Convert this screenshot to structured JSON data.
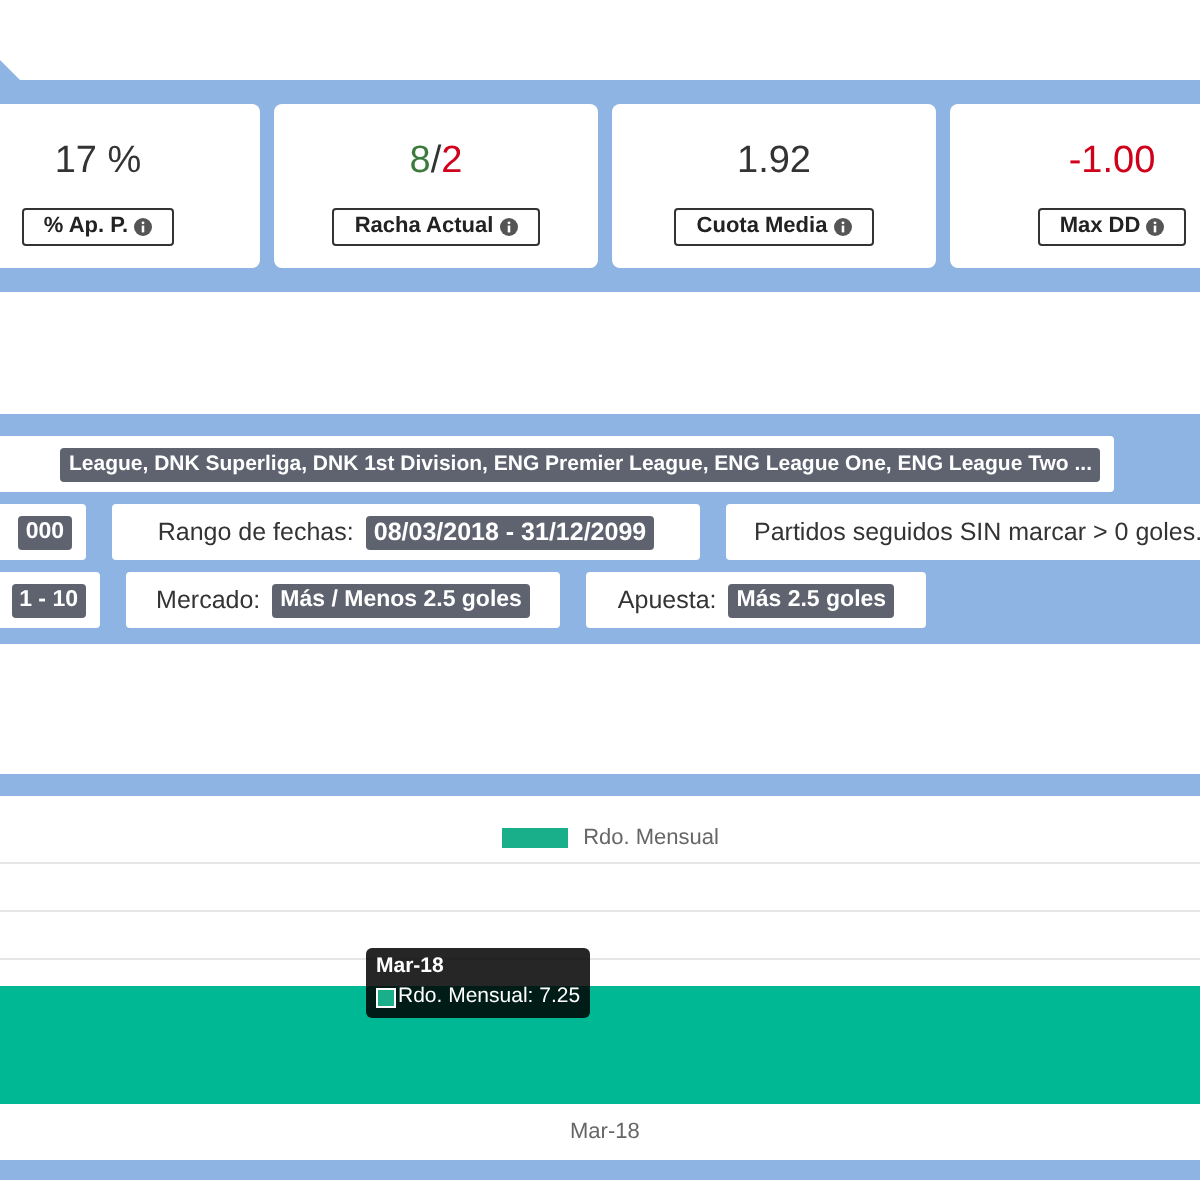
{
  "stats": [
    {
      "kind": "plain",
      "value": "17 %",
      "negative": false,
      "label": "% Ap. P."
    },
    {
      "kind": "streak",
      "wins": "8",
      "separator": "/",
      "losses": "2",
      "label": "Racha Actual"
    },
    {
      "kind": "plain",
      "value": "1.92",
      "negative": false,
      "label": "Cuota Media"
    },
    {
      "kind": "plain",
      "value": "-1.00",
      "negative": true,
      "label": "Max DD"
    }
  ],
  "filters": [
    [
      {
        "value": "League, DNK Superliga, DNK 1st Division, ENG Premier League, ENG League One, ENG League Two ..."
      }
    ],
    [
      {
        "value": "000"
      },
      {
        "label": "Rango de fechas:",
        "value": "08/03/2018 - 31/12/2099"
      },
      {
        "label": "Partidos seguidos SIN marcar > 0 goles."
      }
    ],
    [
      {
        "value": "1 - 10"
      },
      {
        "label": "Mercado:",
        "value": "Más / Menos 2.5 goles"
      },
      {
        "label": "Apuesta:",
        "value": "Más 2.5 goles"
      }
    ]
  ],
  "chart": {
    "legend": "Rdo. Mensual",
    "x_label": "Mar-18",
    "tooltip": {
      "title": "Mar-18",
      "text": "Rdo. Mensual: 7.25"
    }
  }
}
